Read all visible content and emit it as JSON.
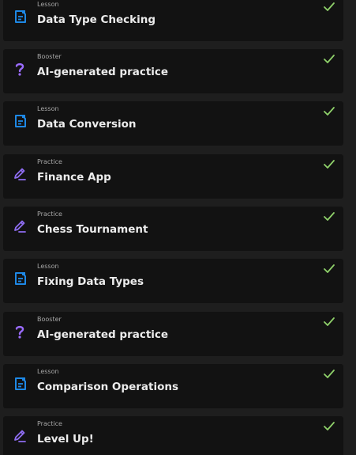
{
  "colors": {
    "lesson_icon": "#1e88e5",
    "booster_icon": "#9b6cff",
    "practice_icon": "#8e6cf0",
    "check": "#8fd16a"
  },
  "items": [
    {
      "type": "Lesson",
      "title": "Data Type Checking",
      "icon": "lesson-document-icon",
      "completed": true
    },
    {
      "type": "Booster",
      "title": "AI-generated practice",
      "icon": "question-mark-icon",
      "completed": true
    },
    {
      "type": "Lesson",
      "title": "Data Conversion",
      "icon": "lesson-document-icon",
      "completed": true
    },
    {
      "type": "Practice",
      "title": "Finance App",
      "icon": "pencil-icon",
      "completed": true
    },
    {
      "type": "Practice",
      "title": "Chess Tournament",
      "icon": "pencil-icon",
      "completed": true
    },
    {
      "type": "Lesson",
      "title": "Fixing Data Types",
      "icon": "lesson-document-icon",
      "completed": true
    },
    {
      "type": "Booster",
      "title": "AI-generated practice",
      "icon": "question-mark-icon",
      "completed": true
    },
    {
      "type": "Lesson",
      "title": "Comparison Operations",
      "icon": "lesson-document-icon",
      "completed": true
    },
    {
      "type": "Practice",
      "title": "Level Up!",
      "icon": "pencil-icon",
      "completed": true
    }
  ]
}
